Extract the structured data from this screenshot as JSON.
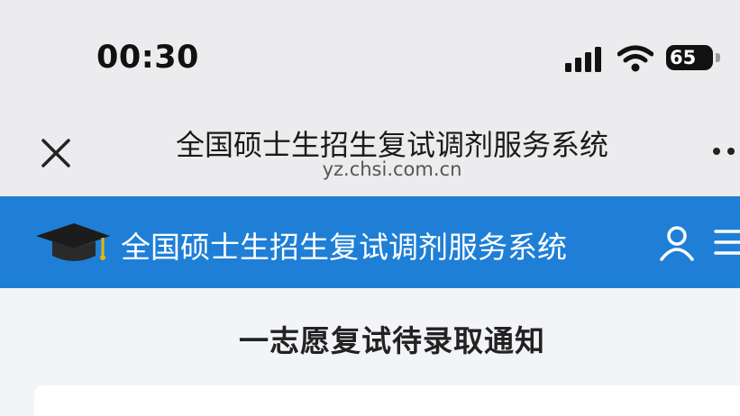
{
  "status_bar": {
    "time": "00:30",
    "battery_level": "65",
    "icons": [
      "signal-icon",
      "wifi-icon",
      "battery-icon"
    ]
  },
  "browser": {
    "title": "全国硕士生招生复试调剂服务系统",
    "url": "yz.chsi.com.cn",
    "icons": [
      "close-icon",
      "more-icon"
    ]
  },
  "site_header": {
    "title": "全国硕士生招生复试调剂服务系统",
    "background_color": "#1f7fd6",
    "icons": [
      "graduation-cap-logo-icon",
      "user-icon",
      "menu-icon"
    ]
  },
  "main": {
    "heading": "一志愿复试待录取通知"
  }
}
